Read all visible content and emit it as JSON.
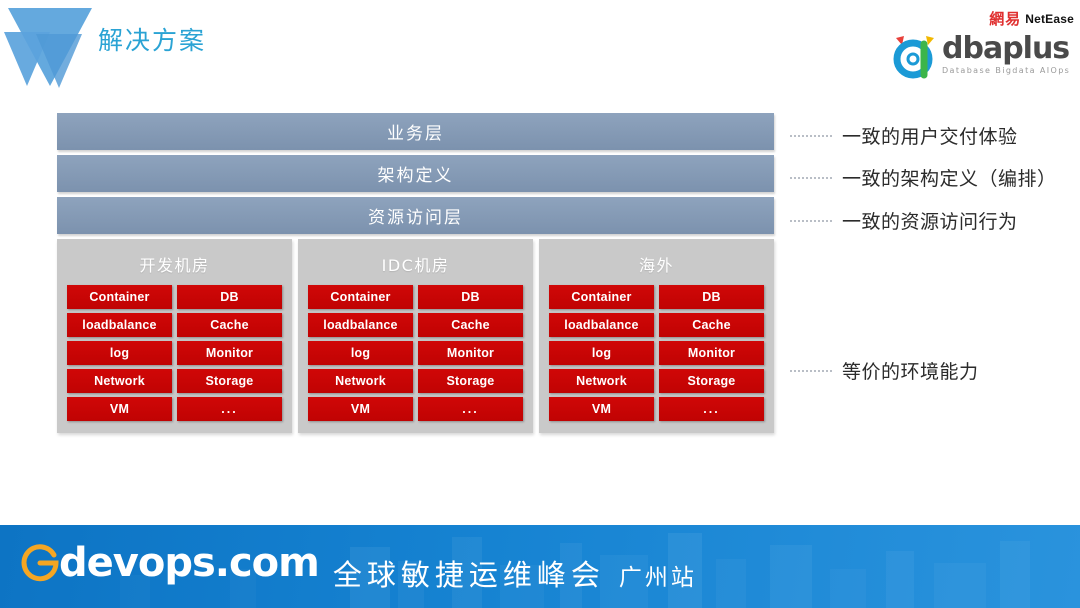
{
  "header": {
    "title": "解决方案",
    "logo_icon": "w-triangle-logo",
    "brands": {
      "netease_cn": "網易",
      "netease_en": "NetEase",
      "dbaplus_name": "dbaplus",
      "dbaplus_tagline": "Database  Bigdata  AIOps",
      "dbaplus_icon": "dbaplus-a-mark"
    }
  },
  "diagram": {
    "layers": [
      {
        "label": "业务层",
        "callout": "一致的用户交付体验"
      },
      {
        "label": "架构定义",
        "callout": "一致的架构定义（编排）"
      },
      {
        "label": "资源访问层",
        "callout": "一致的资源访问行为"
      }
    ],
    "environments_callout": "等价的环境能力",
    "environments": [
      {
        "title": "开发机房",
        "capabilities": [
          "Container",
          "DB",
          "loadbalance",
          "Cache",
          "log",
          "Monitor",
          "Network",
          "Storage",
          "VM",
          "..."
        ]
      },
      {
        "title": "IDC机房",
        "capabilities": [
          "Container",
          "DB",
          "loadbalance",
          "Cache",
          "log",
          "Monitor",
          "Network",
          "Storage",
          "VM",
          "..."
        ]
      },
      {
        "title": "海外",
        "capabilities": [
          "Container",
          "DB",
          "loadbalance",
          "Cache",
          "log",
          "Monitor",
          "Network",
          "Storage",
          "VM",
          "..."
        ]
      }
    ]
  },
  "banner": {
    "domain": "devops.com",
    "g_icon": "g-circle-icon",
    "summit_name": "全球敏捷运维峰会",
    "city": "广州站"
  },
  "colors": {
    "title_blue": "#2aa3d4",
    "layer_bar": "#7c92ae",
    "capability_red": "#c00303",
    "env_panel_gray": "#c9c9c9",
    "banner_blue": "#1683d2",
    "netease_red": "#e03030",
    "g_orange": "#f5a623"
  }
}
